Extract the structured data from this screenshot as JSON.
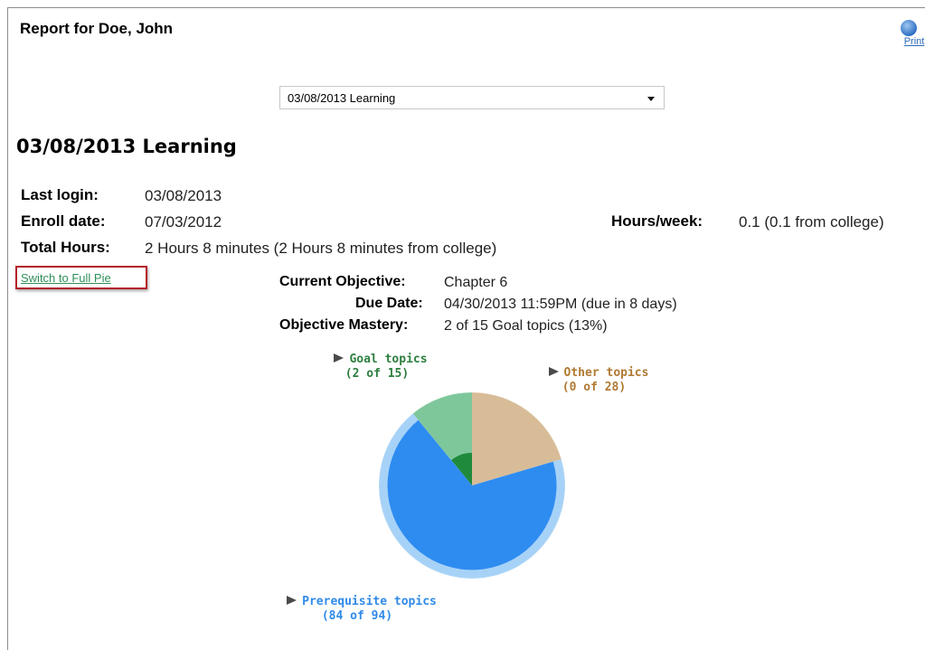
{
  "report": {
    "title": "Report for Doe, John"
  },
  "print": {
    "label": "Print",
    "icon": "print-globe-icon"
  },
  "period_select": {
    "selected": "03/08/2013 Learning"
  },
  "heading": "03/08/2013 Learning",
  "stats": {
    "last_login_label": "Last login:",
    "last_login_value": "03/08/2013",
    "enroll_date_label": "Enroll date:",
    "enroll_date_value": "07/03/2012",
    "hours_week_label": "Hours/week:",
    "hours_week_value": "0.1 (0.1 from college)",
    "total_hours_label": "Total Hours:",
    "total_hours_value": "2 Hours 8 minutes (2 Hours 8 minutes from college)"
  },
  "switch_link": "Switch to Full Pie",
  "objective": {
    "current_label": "Current Objective:",
    "current_value": "Chapter 6",
    "due_label": "Due Date:",
    "due_value": "04/30/2013 11:59PM (due in 8 days)",
    "mastery_label": "Objective Mastery:",
    "mastery_value": "2 of 15 Goal topics (13%)"
  },
  "pie_labels": {
    "goal_title": "Goal topics",
    "goal_count": "(2 of 15)",
    "other_title": "Other topics",
    "other_count": "(0 of 28)",
    "prereq_title": "Prerequisite topics",
    "prereq_count": "(84 of 94)"
  },
  "chart_data": {
    "type": "pie",
    "slices": [
      {
        "name": "Goal topics",
        "mastered": 2,
        "total": 15,
        "color": "#7ec79b",
        "mastered_color": "#1f8a3c"
      },
      {
        "name": "Other topics",
        "mastered": 0,
        "total": 28,
        "color": "#d8bc98",
        "mastered_color": "#a87a3e"
      },
      {
        "name": "Prerequisite topics",
        "mastered": 84,
        "total": 94,
        "color": "#a7d2f7",
        "mastered_color": "#2e8cf0"
      }
    ],
    "label_colors": {
      "goal": "#2d7f3f",
      "other": "#b07a33",
      "prereq": "#2f8ae8"
    }
  }
}
